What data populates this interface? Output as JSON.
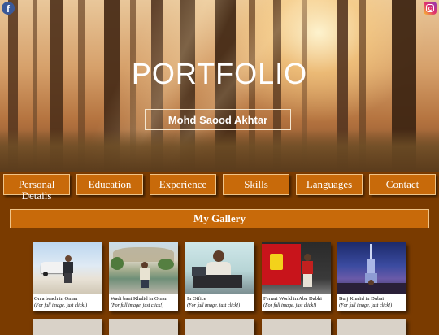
{
  "hero": {
    "title": "PORTFOLIO",
    "name": "Mohd Saood Akhtar",
    "facebook_icon": "facebook-icon",
    "instagram_icon": "instagram-icon"
  },
  "nav": {
    "items": [
      {
        "label": "Personal Details"
      },
      {
        "label": "Education"
      },
      {
        "label": "Experience"
      },
      {
        "label": "Skills"
      },
      {
        "label": "Languages"
      },
      {
        "label": "Contact"
      }
    ]
  },
  "gallery": {
    "title": "My Gallery",
    "items": [
      {
        "caption": "On a beach in Oman",
        "hint": "(For full image, just click!)"
      },
      {
        "caption": "Wadi bani Khalid in Oman",
        "hint": "(For full image, just click!)"
      },
      {
        "caption": "In Office",
        "hint": "(For full image, just click!)"
      },
      {
        "caption": "Ferrari World in Abu Dabhi",
        "hint": "(For full image, just click!)"
      },
      {
        "caption": "Burj Khalid in Dubai",
        "hint": "(For full image, just click!)"
      }
    ]
  },
  "colors": {
    "page_background": "#7a3b00",
    "button_background": "#c86a0a",
    "button_border": "#f0c488",
    "facebook_blue": "#3b5998"
  }
}
